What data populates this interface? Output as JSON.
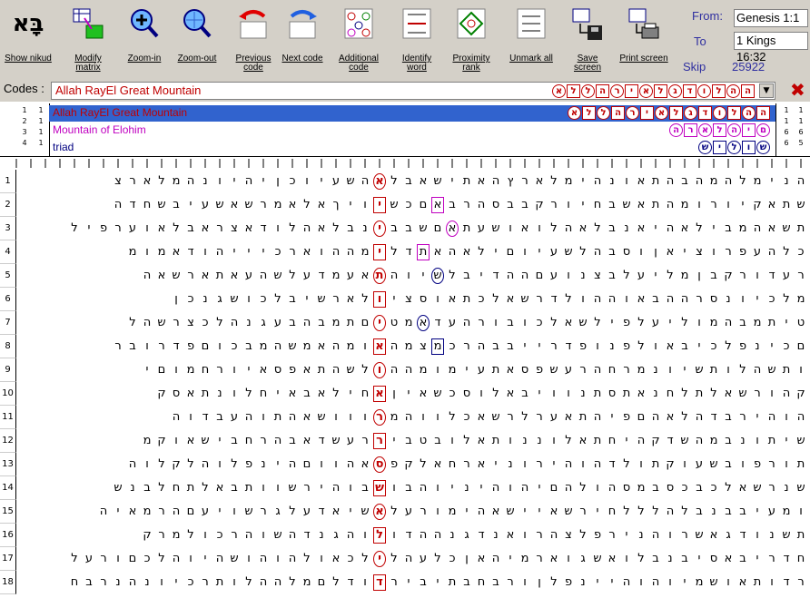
{
  "toolbar": {
    "buttons": [
      {
        "id": "show-nikud",
        "label": "Show nikud",
        "icon": "show-nikud-icon"
      },
      {
        "id": "modify-matrix",
        "label": "Modify matrix",
        "icon": "modify-matrix-icon"
      },
      {
        "id": "zoom-in",
        "label": "Zoom-in",
        "icon": "zoom-in-icon"
      },
      {
        "id": "zoom-out",
        "label": "Zoom-out",
        "icon": "zoom-out-icon"
      },
      {
        "id": "previous-code",
        "label": "Previous code",
        "icon": "previous-code-icon"
      },
      {
        "id": "next-code",
        "label": "Next code",
        "icon": "next-code-icon"
      },
      {
        "id": "additional-code",
        "label": "Additional code",
        "icon": "additional-code-icon"
      },
      {
        "id": "identify-word",
        "label": "Identify word",
        "icon": "identify-word-icon"
      },
      {
        "id": "proximity-rank",
        "label": "Proximity rank",
        "icon": "proximity-rank-icon"
      },
      {
        "id": "unmark-all",
        "label": "Unmark all",
        "icon": "unmark-all-icon"
      },
      {
        "id": "save-screen",
        "label": "Save screen",
        "icon": "save-screen-icon"
      },
      {
        "id": "print-screen",
        "label": "Print screen",
        "icon": "print-screen-icon"
      }
    ],
    "nikud_glyph": "בָּא",
    "from_label": "From:",
    "from_value": "Genesis 1:1",
    "to_label": "To",
    "to_value": "1 Kings 16:32",
    "skip_label": "Skip",
    "skip_value": "25922"
  },
  "codes": {
    "label": "Codes :",
    "selected": "Allah RayEl Great Mountain",
    "letters": "אללהריאלגדולהה",
    "close_glyph": "✖"
  },
  "terms": [
    {
      "name": "Allah RayEl Great Mountain",
      "letters": "אללהריאלגדולהה",
      "color": "#c00000",
      "selected": true
    },
    {
      "name": "Mountain of Elohim",
      "letters": "הראלהים",
      "color": "#c000c0",
      "selected": false
    },
    {
      "name": "triad",
      "letters": "שילוש",
      "color": "#000080",
      "selected": false
    }
  ],
  "colors": {
    "red": "#c00000",
    "magenta": "#c000c0",
    "navy": "#000080",
    "toolbar_bg": "#d4d0c8",
    "selection": "#3163ce",
    "label_blue": "#2f2fa0"
  },
  "grid_rows": [
    "הנימלהמהבהתאונהימלארץהאתישאבלאהשעיוכןיהיונהמלארצ",
    "שתאקיורומהתאשבחיורקבבסהרבאםכשיויךאלאמרשאשעיבשחדה",
    "תשאהמבילאהיאנבלאהלואושעתאםשבבינבלאהלודאצראבלאוערפיל",
    "כלהעפרוציאןוסבהלשעיוםילאהאתדלימההוארכיייהודאמומ",
    "רעדורקבןמליעלבצנועםההדיבלשיוהתאעמדעלשהעאתארשאה",
    "מלכיונסרההבאוההולדרשאלכתאוסציולארשיבלכושגנכן",
    "טיתמבהמוליעלפילשאלכובורהעדאמטיםתמבהבעגנהלכצרשהל",
    "םכינפלכיבאולפנופדרייבבהרכמצמהאומהאמשהמבכוםפדרובר",
    "ותשהלותשיונמרחהרעשפסאתעימומההולשהתאפסאיורחמוםי",
    "קהורשאלתלחנאתסתנוויבאלוסכשאיןאחילאבאיחלונתאסק",
    "הוהירבדהלאהםפיהתאערלרשאכלווהמרווושאהתוהעבדוה",
    "שיתונבמהשדקהיחתאלוננותאלובטביררעשדאבהרחבישאוקמ",
    "תורפובשעוקתולדהוהירוניארחאלקפסאהווםהינפלוהלקלוה",
    "שנרשאלכבכסבמסהולהםיהוהיניוהבושבוהירשוותבאלתחלבנש",
    "ומעיבבנבלהלללחירשאיישאהימורעלאשיאדעלגרשויעםהרמאיה",
    "תשנודגאשרוהנירפלצהרואנדגנההדולוהגנדהשוהרכולמרק",
    "חדריבאסיבנבלואשגוארמיהאןכלעהלילכאולהוהושהיוהלכםורעל",
    "רדותאושמיוהוהיינפלןורבחבתיבירדודלםמלההלותרכיונהנרבח"
  ],
  "row_numbers": [
    "1",
    "2",
    "3",
    "4",
    "5",
    "6",
    "7",
    "8",
    "9",
    "10",
    "11",
    "12",
    "13",
    "14",
    "15",
    "16",
    "17",
    "18"
  ]
}
